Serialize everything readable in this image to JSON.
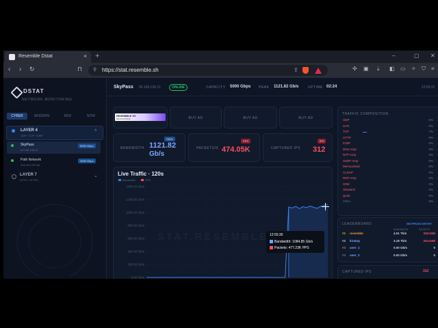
{
  "browser": {
    "tab_title": "Resemble Dstat",
    "new_tab": "+",
    "url": "https://stat.resemble.sh",
    "controls": {
      "minimize": "–",
      "maximize": "▢",
      "close": "✕"
    }
  },
  "sidebar": {
    "brand": "DSTAT",
    "subtitle": "NETWORK MONITORING",
    "tabs": [
      "CYBER",
      "MODERN",
      "RED",
      "NOW"
    ],
    "layer4": {
      "title": "LAYER 4",
      "subtitle": "UDP / TCP / ICMP"
    },
    "nodes": [
      {
        "name": "SkyPass",
        "ip": "83.169.106.21",
        "badge": "5000 Gbps"
      },
      {
        "name": "Path Network",
        "ip": "206.223.237.88",
        "badge": "2000 Gbps"
      }
    ],
    "layer7": {
      "title": "LAYER 7",
      "subtitle": "HTTP / HTTPS"
    }
  },
  "header": {
    "server_name": "SkyPass",
    "ip": "83.169.106.21",
    "status": "ONLINE",
    "capacity_label": "CAPACITY",
    "capacity_value": "5000 Gbps",
    "peak_label": "PEAK",
    "peak_value": "1121.82 Gb/s",
    "uptime_label": "UPTIME",
    "uptime_value": "02:24",
    "clock": "12:55:31"
  },
  "ads": {
    "banner_title": "RESEMBLE XV",
    "banner_sub": "DDOS ATTACK",
    "slots": [
      "BUY AD",
      "BUY AD",
      "BUY AD"
    ]
  },
  "stats": {
    "bandwidth": {
      "label": "BANDWIDTH",
      "chip": "GB/S",
      "value": "1121.82",
      "unit": "Gb/s"
    },
    "packets": {
      "label": "PACKETS/S",
      "chip": "PPS",
      "value": "474.05K"
    },
    "captured": {
      "label": "CAPTURED IPS",
      "chip": "IPS",
      "value": "312"
    }
  },
  "chart_data": {
    "type": "line",
    "title": "Live Traffic · 120s",
    "legend": [
      "Bandwidth",
      "PPS"
    ],
    "y_ticks": [
      "1400.00 Gb/s",
      "1200.00 Gb/s",
      "1000.00 Gb/s",
      "800.00 Gb/s",
      "600.00 Gb/s",
      "400.00 Gb/s",
      "200.00 Gb/s",
      "0.00 Gb/s"
    ],
    "ylim": [
      0,
      1400
    ],
    "series": [
      {
        "name": "Bandwidth",
        "color": "#3b82f6",
        "values": [
          0,
          0,
          0,
          0,
          0,
          0,
          0,
          0,
          0,
          0,
          0,
          0,
          0,
          0,
          0,
          0,
          0,
          0,
          0,
          0,
          0,
          0,
          0,
          0,
          0,
          0,
          0,
          0,
          0,
          0,
          0,
          0,
          0,
          0,
          0,
          0,
          0,
          0,
          0,
          0,
          1084.85,
          1070,
          1095,
          1060,
          1090,
          1075,
          1100,
          1080,
          1065,
          1095,
          1110,
          1121.82
        ]
      }
    ],
    "tooltip": {
      "time": "12:55:30",
      "bandwidth": "Bandwidth: 1084.85 Gb/s",
      "packets": "Packets: 477.23K PPS"
    }
  },
  "watermark": "STAT.RESEMBLE.SH",
  "traffic": {
    "title": "TRAFFIC COMPOSITION",
    "rows": [
      {
        "name": "UDP",
        "pct": "0%",
        "fill": 0
      },
      {
        "name": "SYN",
        "pct": "0%",
        "fill": 0
      },
      {
        "name": "TCP",
        "pct": "7%",
        "fill": 0.07
      },
      {
        "name": "HTTP",
        "pct": "0%",
        "fill": 0
      },
      {
        "name": "ICMP",
        "pct": "0%",
        "fill": 0
      },
      {
        "name": "DNS Amp",
        "pct": "0%",
        "fill": 0
      },
      {
        "name": "NTP Amp",
        "pct": "0%",
        "fill": 0
      },
      {
        "name": "SSDP Amp",
        "pct": "0%",
        "fill": 0
      },
      {
        "name": "Memcached",
        "pct": "0%",
        "fill": 0
      },
      {
        "name": "CLDAP",
        "pct": "0%",
        "fill": 0
      },
      {
        "name": "RDP Amp",
        "pct": "0%",
        "fill": 0
      },
      {
        "name": "GRE",
        "pct": "0%",
        "fill": 0
      },
      {
        "name": "Slowloris",
        "pct": "0%",
        "fill": 0
      },
      {
        "name": "QUIC",
        "pct": "0%",
        "fill": 0
      },
      {
        "name": "Other",
        "pct": "0%",
        "fill": 0
      }
    ]
  },
  "leaderboard": {
    "title": "LEADERBOARD",
    "server": "SKYPASS DSTAT",
    "col_bw": "BANDWIDTH",
    "col_pk": "PACKETS",
    "rows": [
      {
        "rank": "#1",
        "name": "resemble",
        "bw": "4.01 Tb/s",
        "pk": "329.53M"
      },
      {
        "rank": "#2",
        "name": "kiratop",
        "bw": "3.18 Tb/s",
        "pk": "254.64M"
      },
      {
        "rank": "#3",
        "name": "user_1",
        "bw": "0.00 Gb/s",
        "pk": "0"
      },
      {
        "rank": "#4",
        "name": "user_2",
        "bw": "0.00 Gb/s",
        "pk": "0"
      }
    ]
  },
  "captured_panel": {
    "title": "CAPTURED IPS",
    "count": "312"
  },
  "colors": {
    "accent": "#3b82f6",
    "danger": "#ff4d5f",
    "online": "#22c55e",
    "bg": "#0e1524"
  }
}
